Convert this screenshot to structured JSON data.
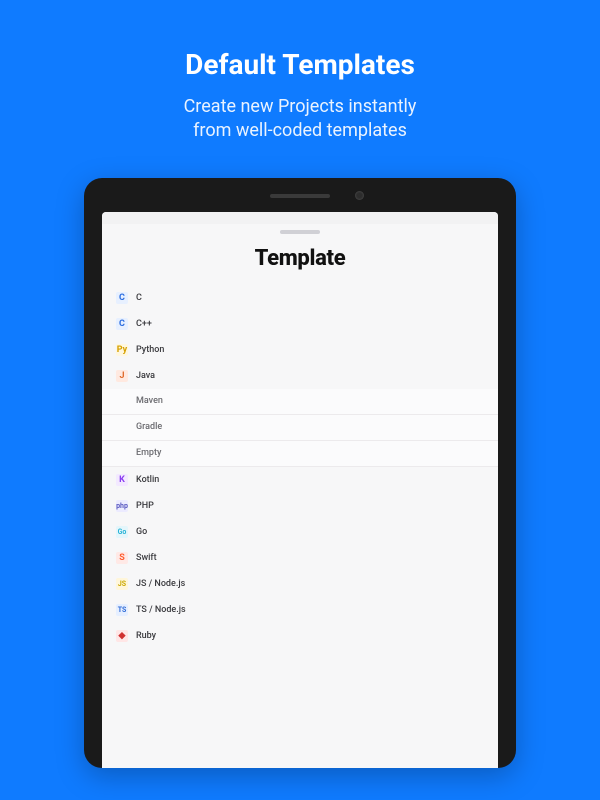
{
  "promo": {
    "headline": "Default Templates",
    "sub_line1": "Create new Projects instantly",
    "sub_line2": "from well-coded templates"
  },
  "sheet": {
    "title": "Template",
    "items": [
      {
        "label": "C",
        "icon": "C",
        "cls": "c-blue"
      },
      {
        "label": "C++",
        "icon": "C",
        "cls": "c-bluec"
      },
      {
        "label": "Python",
        "icon": "Py",
        "cls": "c-py"
      },
      {
        "label": "Java",
        "icon": "J",
        "cls": "c-java",
        "children": [
          {
            "label": "Maven"
          },
          {
            "label": "Gradle"
          },
          {
            "label": "Empty"
          }
        ]
      },
      {
        "label": "Kotlin",
        "icon": "K",
        "cls": "c-kot"
      },
      {
        "label": "PHP",
        "icon": "php",
        "cls": "c-php"
      },
      {
        "label": "Go",
        "icon": "Go",
        "cls": "c-go"
      },
      {
        "label": "Swift",
        "icon": "S",
        "cls": "c-swift"
      },
      {
        "label": "JS / Node.js",
        "icon": "JS",
        "cls": "c-js"
      },
      {
        "label": "TS / Node.js",
        "icon": "TS",
        "cls": "c-ts"
      },
      {
        "label": "Ruby",
        "icon": "◆",
        "cls": "c-ruby"
      }
    ]
  }
}
